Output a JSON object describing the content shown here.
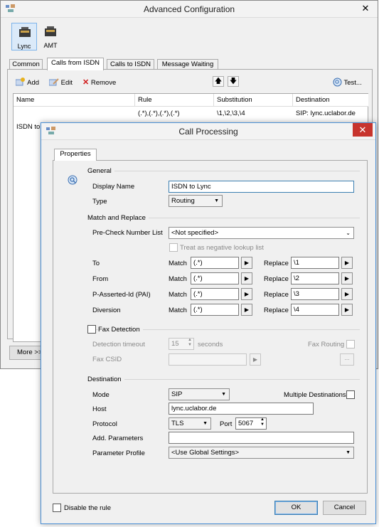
{
  "main_window": {
    "title": "Advanced Configuration",
    "close": "✕",
    "devices": [
      {
        "label": "Lync"
      },
      {
        "label": "AMT"
      }
    ],
    "tabs": [
      "Common",
      "Calls from ISDN",
      "Calls to ISDN",
      "Message Waiting"
    ],
    "active_tab": "Calls from ISDN",
    "toolbar": {
      "add": "Add",
      "edit": "Edit",
      "remove": "Remove",
      "test": "Test..."
    },
    "columns": [
      "Name",
      "Rule",
      "Substitution",
      "Destination"
    ],
    "rows": [
      {
        "name": "ISDN to Lync",
        "rule": "(.*),(.*),(.*),(.*)",
        "substitution": "\\1,\\2,\\3,\\4",
        "destination": "SIP: lync.uclabor.de"
      }
    ],
    "more_label": "More >>"
  },
  "dialog": {
    "title": "Call Processing",
    "close": "✕",
    "tab": "Properties",
    "general": {
      "heading": "General",
      "display_name_label": "Display Name",
      "display_name_value": "ISDN to Lync",
      "type_label": "Type",
      "type_value": "Routing"
    },
    "match_replace": {
      "heading": "Match and Replace",
      "precheck_label": "Pre-Check Number List",
      "precheck_value": "<Not specified>",
      "negative_label": "Treat as negative lookup list",
      "match_label": "Match",
      "replace_label": "Replace",
      "rows": [
        {
          "label": "To",
          "match": "(.*)",
          "replace": "\\1"
        },
        {
          "label": "From",
          "match": "(.*)",
          "replace": "\\2"
        },
        {
          "label": "P-Asserted-Id (PAI)",
          "match": "(.*)",
          "replace": "\\3"
        },
        {
          "label": "Diversion",
          "match": "(.*)",
          "replace": "\\4"
        }
      ]
    },
    "fax": {
      "heading": "Fax Detection",
      "timeout_label": "Detection timeout",
      "timeout_value": "15",
      "seconds_label": "seconds",
      "routing_label": "Fax Routing",
      "csid_label": "Fax CSID",
      "browse": "..."
    },
    "destination": {
      "heading": "Destination",
      "mode_label": "Mode",
      "mode_value": "SIP",
      "multiple_label": "Multiple Destinations",
      "host_label": "Host",
      "host_value": "lync.uclabor.de",
      "protocol_label": "Protocol",
      "protocol_value": "TLS",
      "port_label": "Port",
      "port_value": "5067",
      "params_label": "Add. Parameters",
      "profile_label": "Parameter Profile",
      "profile_value": "<Use Global Settings>"
    },
    "disable_label": "Disable the rule",
    "ok": "OK",
    "cancel": "Cancel"
  }
}
